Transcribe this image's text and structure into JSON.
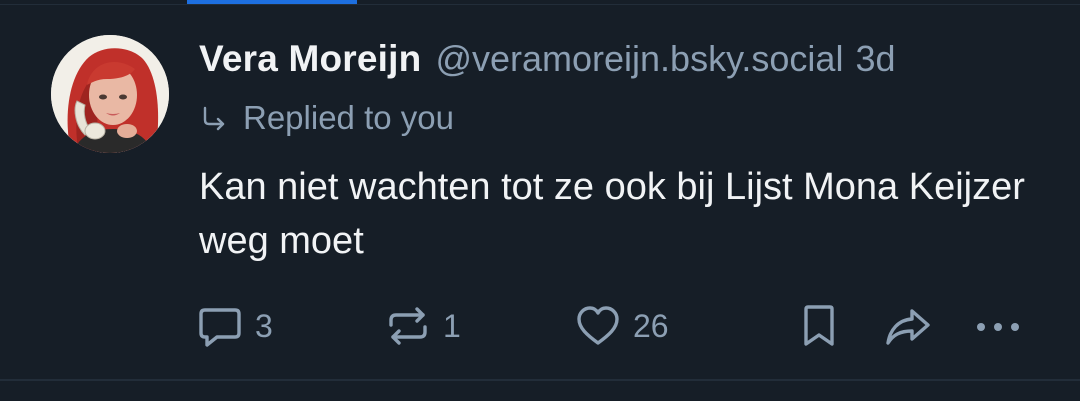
{
  "colors": {
    "background": "#161e27",
    "accent": "#1d6fe0",
    "text_primary": "#f1f3f5",
    "text_secondary": "#8c9fb3",
    "divider": "#222d39"
  },
  "post": {
    "author": {
      "display_name": "Vera Moreijn",
      "handle": "@veramoreijn.bsky.social",
      "avatar_icon": "avatar-photo"
    },
    "timestamp": "3d",
    "reply_context": {
      "icon": "reply-arrow-icon",
      "text": "Replied to you"
    },
    "text": "Kan niet wachten tot ze ook bij Lijst Mona Keijzer weg moet",
    "actions": {
      "reply": {
        "icon": "comment-icon",
        "count": "3"
      },
      "repost": {
        "icon": "repost-icon",
        "count": "1"
      },
      "like": {
        "icon": "heart-icon",
        "count": "26"
      },
      "bookmark": {
        "icon": "bookmark-icon"
      },
      "share": {
        "icon": "share-icon"
      },
      "more": {
        "icon": "more-icon"
      }
    }
  }
}
